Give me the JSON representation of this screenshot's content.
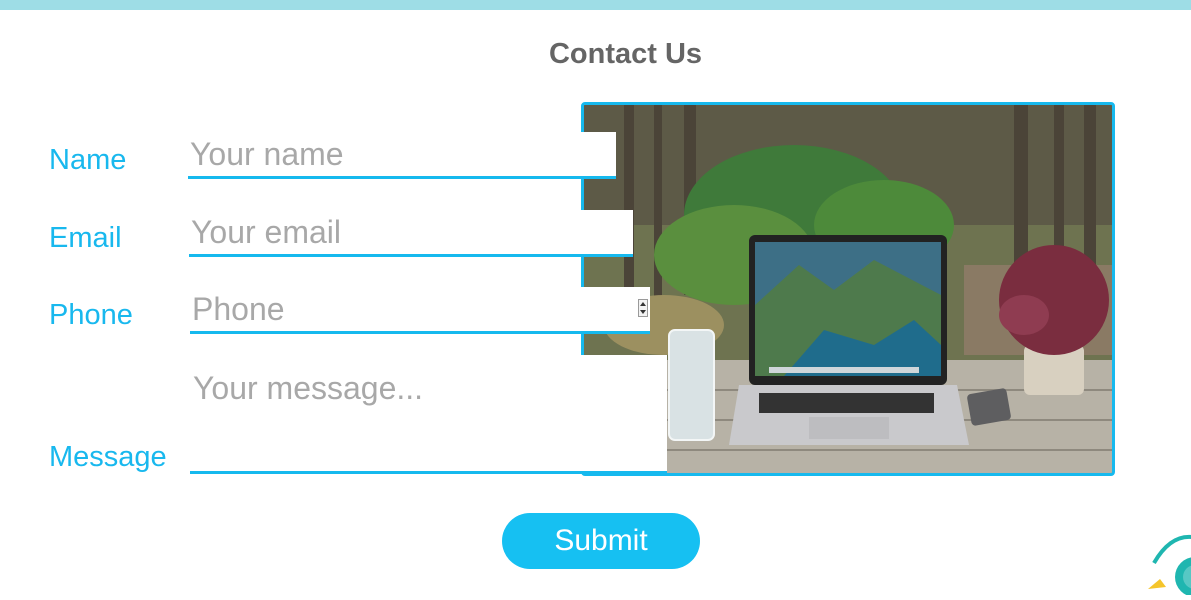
{
  "header": {
    "title": "Contact Us"
  },
  "form": {
    "name_label": "Name",
    "name_placeholder": "Your name",
    "email_label": "Email",
    "email_placeholder": "Your email",
    "phone_label": "Phone",
    "phone_placeholder": "Phone",
    "message_label": "Message",
    "message_placeholder": "Your message...",
    "submit_label": "Submit"
  },
  "image": {
    "icon": "laptop-on-table-photo"
  },
  "badge": {
    "icon": "we-are-online-badge-icon"
  },
  "colors": {
    "accent": "#16b9ee",
    "button": "#16c0f2",
    "topbar": "#9edde6",
    "title": "#656565"
  }
}
